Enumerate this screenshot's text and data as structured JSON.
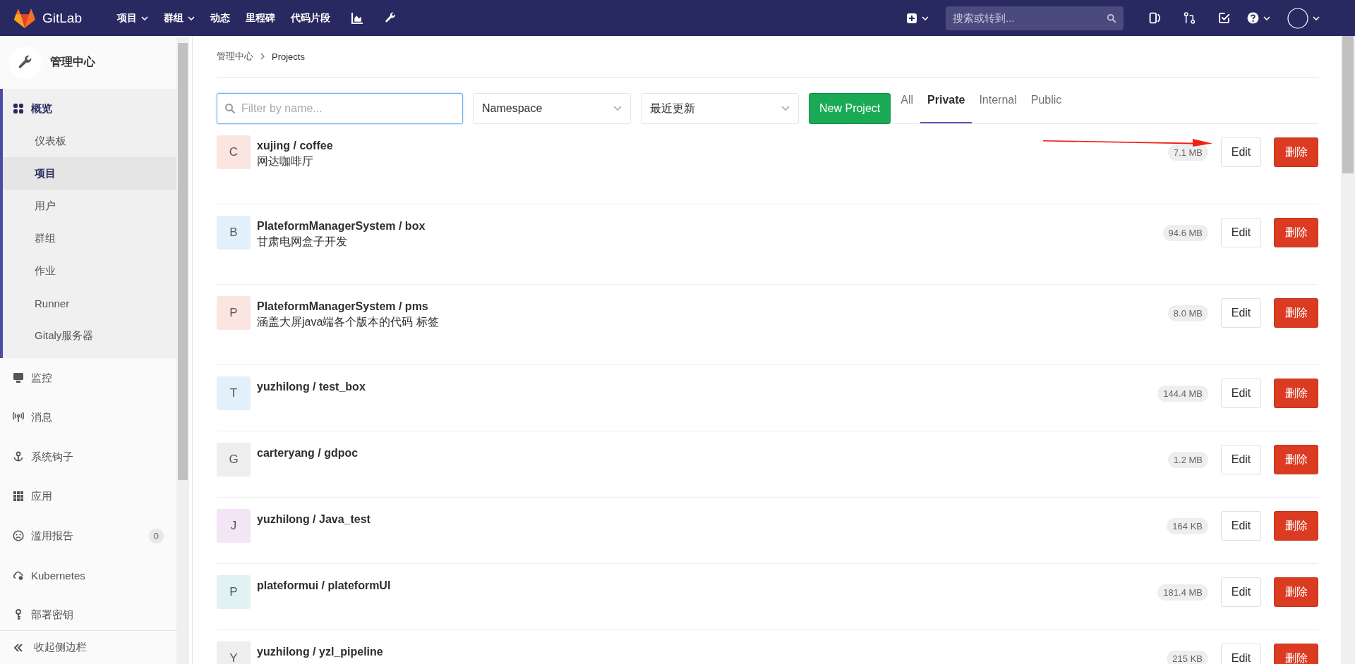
{
  "top_nav": {
    "brand": "GitLab",
    "menu": [
      {
        "label": "项目",
        "dropdown": true
      },
      {
        "label": "群组",
        "dropdown": true
      },
      {
        "label": "动态",
        "dropdown": false
      },
      {
        "label": "里程碑",
        "dropdown": false
      },
      {
        "label": "代码片段",
        "dropdown": false
      }
    ],
    "search": {
      "placeholder": "搜索或转到..."
    }
  },
  "sidebar": {
    "title": "管理中心",
    "items": [
      {
        "label": "概览",
        "selected": true,
        "children": [
          {
            "label": "仪表板",
            "selected": false
          },
          {
            "label": "项目",
            "selected": true
          },
          {
            "label": "用户",
            "selected": false
          },
          {
            "label": "群组",
            "selected": false
          },
          {
            "label": "作业",
            "selected": false
          },
          {
            "label": "Runner",
            "selected": false
          },
          {
            "label": "Gitaly服务器",
            "selected": false
          }
        ]
      },
      {
        "label": "监控",
        "selected": false
      },
      {
        "label": "消息",
        "selected": false
      },
      {
        "label": "系统钩子",
        "selected": false
      },
      {
        "label": "应用",
        "selected": false
      },
      {
        "label": "滥用报告",
        "selected": false,
        "badge": "0"
      },
      {
        "label": "Kubernetes",
        "selected": false
      },
      {
        "label": "部署密钥",
        "selected": false
      }
    ],
    "collapse": "收起侧边栏"
  },
  "breadcrumb": [
    "管理中心",
    "Projects"
  ],
  "filters": {
    "search": {
      "placeholder": "Filter by name..."
    },
    "namespace": "Namespace",
    "sort": "最近更新",
    "new_button": "New Project"
  },
  "tabs": [
    {
      "label": "All",
      "selected": false
    },
    {
      "label": "Private",
      "selected": true
    },
    {
      "label": "Internal",
      "selected": false
    },
    {
      "label": "Public",
      "selected": false
    }
  ],
  "projects": [
    {
      "letter": "C",
      "color": "#fbe5e1",
      "name": "xujing / coffee",
      "description": "网达咖啡厅",
      "size": "7.1 MB",
      "edit": "Edit",
      "delete": "删除"
    },
    {
      "letter": "B",
      "color": "#e1f0fb",
      "name": "PlateformManagerSystem / box",
      "description": "甘肃电网盒子开发",
      "size": "94.6 MB",
      "edit": "Edit",
      "delete": "删除"
    },
    {
      "letter": "P",
      "color": "#fbe5e1",
      "name": "PlateformManagerSystem / pms",
      "description": "涵盖大屏java端各个版本的代码 标签",
      "size": "8.0 MB",
      "edit": "Edit",
      "delete": "删除"
    },
    {
      "letter": "T",
      "color": "#e1f0fb",
      "name": "yuzhilong / test_box",
      "size": "144.4 MB",
      "edit": "Edit",
      "delete": "删除"
    },
    {
      "letter": "G",
      "color": "#eeeeee",
      "name": "carteryang / gdpoc",
      "size": "1.2 MB",
      "edit": "Edit",
      "delete": "删除"
    },
    {
      "letter": "J",
      "color": "#f3e5f5",
      "name": "yuzhilong / Java_test",
      "size": "164 KB",
      "edit": "Edit",
      "delete": "删除"
    },
    {
      "letter": "P",
      "color": "#e0f2f1",
      "name": "plateformui / plateformUI",
      "size": "181.4 MB",
      "edit": "Edit",
      "delete": "删除"
    },
    {
      "letter": "Y",
      "color": "#eeeeee",
      "name": "yuzhilong / yzl_pipeline",
      "size": "215 KB",
      "edit": "Edit",
      "delete": "删除"
    }
  ]
}
